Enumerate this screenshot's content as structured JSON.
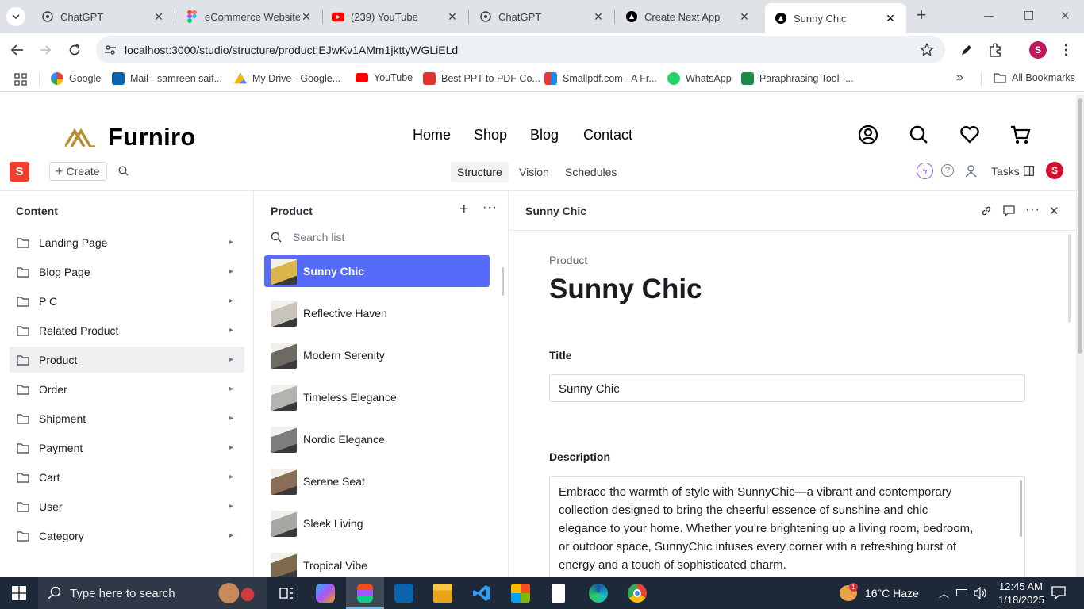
{
  "browser": {
    "tabs": [
      {
        "title": "ChatGPT",
        "icon": "chatgpt-icon"
      },
      {
        "title": "eCommerce Website",
        "icon": "figma-icon"
      },
      {
        "title": "(239) YouTube",
        "icon": "youtube-icon"
      },
      {
        "title": "ChatGPT",
        "icon": "chatgpt-icon"
      },
      {
        "title": "Create Next App",
        "icon": "nextjs-icon"
      },
      {
        "title": "Sunny Chic",
        "icon": "sanity-icon",
        "active": true
      }
    ],
    "url": "localhost:3000/studio/structure/product;EJwKv1AMm1jkttyWGLiELd",
    "bookmarks": [
      {
        "label": "Google",
        "color": "#4285f4"
      },
      {
        "label": "Mail - samreen saif...",
        "color": "#0a64ad"
      },
      {
        "label": "My Drive - Google...",
        "color": "#f4b400"
      },
      {
        "label": "YouTube",
        "color": "#ff0000"
      },
      {
        "label": "Best PPT to PDF Co...",
        "color": "#e5322d"
      },
      {
        "label": "Smallpdf.com - A Fr...",
        "color": "#e53935"
      },
      {
        "label": "WhatsApp",
        "color": "#25d366"
      },
      {
        "label": "Paraphrasing Tool -...",
        "color": "#1b8a4b"
      }
    ],
    "all_bookmarks": "All Bookmarks",
    "profile_initial": "S"
  },
  "site": {
    "brand": "Furniro",
    "menu": [
      "Home",
      "Shop",
      "Blog",
      "Contact"
    ]
  },
  "studio": {
    "create_label": "Create",
    "tabs": [
      "Structure",
      "Vision",
      "Schedules"
    ],
    "tasks_label": "Tasks",
    "avatar_initial": "S"
  },
  "content_pane": {
    "title": "Content",
    "items": [
      "Landing Page",
      "Blog Page",
      "P C",
      "Related Product",
      "Product",
      "Order",
      "Shipment",
      "Payment",
      "Cart",
      "User",
      "Category"
    ],
    "selected": "Product"
  },
  "product_pane": {
    "title": "Product",
    "search_placeholder": "Search list",
    "items": [
      {
        "name": "Sunny Chic",
        "thumb": "#d9b54a"
      },
      {
        "name": "Reflective Haven",
        "thumb": "#c9c4bb"
      },
      {
        "name": "Modern Serenity",
        "thumb": "#6d6a63"
      },
      {
        "name": "Timeless Elegance",
        "thumb": "#b4b3b0"
      },
      {
        "name": "Nordic Elegance",
        "thumb": "#7b7d7e"
      },
      {
        "name": "Serene Seat",
        "thumb": "#8c6d55"
      },
      {
        "name": "Sleek Living",
        "thumb": "#a7a8a3"
      },
      {
        "name": "Tropical Vibe",
        "thumb": "#7e6b4f"
      }
    ]
  },
  "document": {
    "header": "Sunny Chic",
    "type": "Product",
    "heading": "Sunny Chic",
    "title_label": "Title",
    "title_value": "Sunny Chic",
    "description_label": "Description",
    "description_lines": [
      "Embrace the warmth of style with SunnyChic—a vibrant and contemporary",
      "collection designed to bring the cheerful essence of sunshine and chic",
      "elegance to your home. Whether you're brightening up a living room, bedroom,",
      "or outdoor space, SunnyChic infuses every corner with a refreshing burst of",
      "energy and a touch of sophisticated charm."
    ]
  },
  "taskbar": {
    "search_placeholder": "Type here to search",
    "weather": "16°C  Haze",
    "time": "12:45 AM",
    "date": "1/18/2025",
    "notification_count": "1"
  }
}
